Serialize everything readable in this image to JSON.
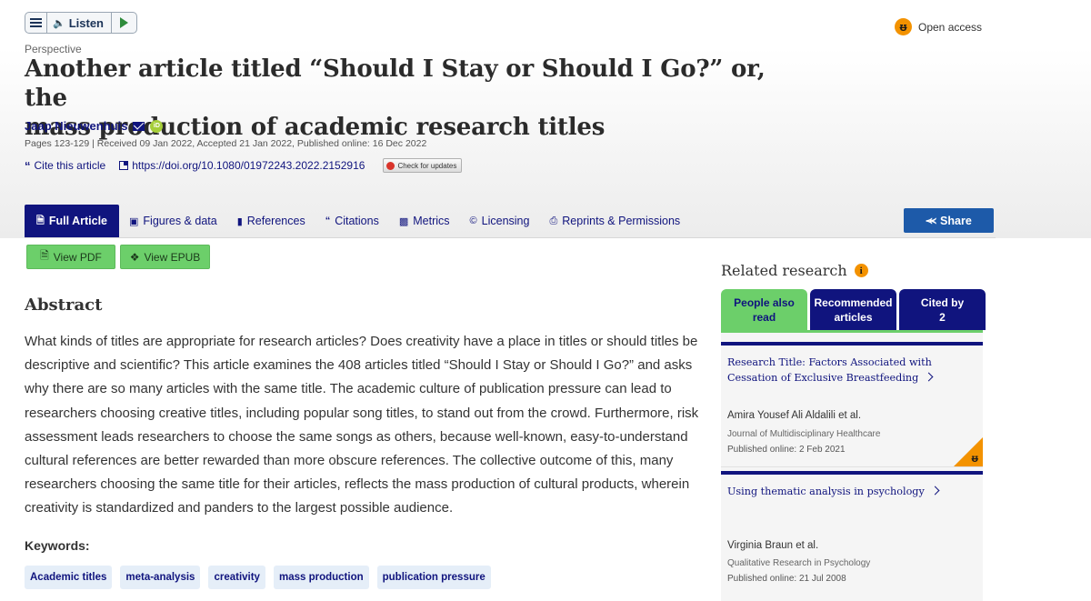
{
  "listen": {
    "label": "Listen"
  },
  "open_access": {
    "label": "Open access"
  },
  "article": {
    "type": "Perspective",
    "title_line1": "Another article titled “Should I Stay or Should I Go?” or, the",
    "title_line2": "mass production of academic research titles",
    "author": "Jaap Nieuwenhuis",
    "meta": "Pages 123-129 | Received 09 Jan 2022, Accepted 21 Jan 2022, Published online: 16 Dec 2022",
    "cite_label": "Cite this article",
    "doi": "https://doi.org/10.1080/01972243.2022.2152916",
    "check_updates": "Check for updates"
  },
  "tabs": [
    {
      "label": "Full Article",
      "icon": "file-text-icon",
      "active": true
    },
    {
      "label": "Figures & data",
      "icon": "image-icon"
    },
    {
      "label": "References",
      "icon": "book-icon"
    },
    {
      "label": "Citations",
      "icon": "quote-icon"
    },
    {
      "label": "Metrics",
      "icon": "bar-chart-icon"
    },
    {
      "label": "Licensing",
      "icon": "copyright-icon"
    },
    {
      "label": "Reprints & Permissions",
      "icon": "print-icon"
    }
  ],
  "share_label": "Share",
  "view_pdf": "View PDF",
  "view_epub": "View EPUB",
  "abstract": {
    "heading": "Abstract",
    "text": "What kinds of titles are appropriate for research articles? Does creativity have a place in titles or should titles be descriptive and scientific? This article examines the 408 articles titled “Should I Stay or Should I Go?” and asks why there are so many articles with the same title. The academic culture of publication pressure can lead to researchers choosing creative titles, including popular song titles, to stand out from the crowd. Furthermore, risk assessment leads researchers to choose the same songs as others, because well-known, easy-to-understand cultural references are better rewarded than more obscure references. The collective outcome of this, many researchers choosing the same title for their articles, reflects the mass production of cultural products, wherein creativity is standardized and panders to the largest possible audience."
  },
  "keywords": {
    "heading": "Keywords:",
    "items": [
      "Academic titles",
      "meta-analysis",
      "creativity",
      "mass production",
      "publication pressure"
    ]
  },
  "related": {
    "heading": "Related research",
    "tabs": [
      {
        "line1": "People also",
        "line2": "read"
      },
      {
        "line1": "Recommended",
        "line2": "articles"
      },
      {
        "line1": "Cited by",
        "line2": "2"
      }
    ],
    "cards": [
      {
        "title": "Research Title: Factors Associated with Cessation of Exclusive Breastfeeding",
        "authors": "Amira Yousef Ali Aldalili et al.",
        "journal": "Journal of Multidisciplinary Healthcare",
        "date": "Published online: 2 Feb 2021"
      },
      {
        "title": "Using thematic analysis in psychology",
        "authors": "Virginia Braun et al.",
        "journal": "Qualitative Research in Psychology",
        "date": "Published online: 21 Jul 2008"
      }
    ]
  },
  "colors": {
    "brand_navy": "#10147e",
    "accent_green": "#6ccf6a",
    "open_access_orange": "#f39200",
    "share_blue": "#1d5aa9"
  }
}
